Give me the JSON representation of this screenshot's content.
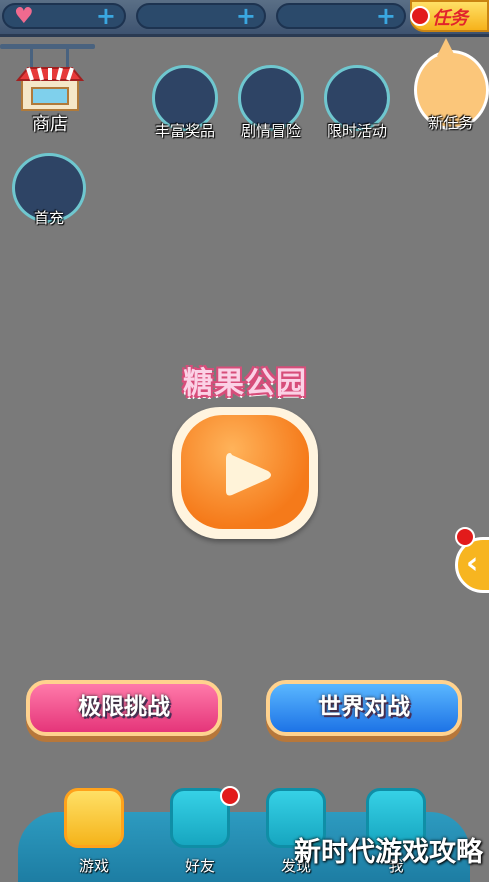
{
  "topbar": {
    "heart_icon": "heart-icon",
    "plus": "+",
    "task_label": "任务"
  },
  "side": {
    "shop_label": "商店",
    "first_recharge_label": "首充"
  },
  "activities": [
    {
      "label": "丰富奖品"
    },
    {
      "label": "剧情冒险"
    },
    {
      "label": "限时活动"
    }
  ],
  "new_task_label": "新任务",
  "center": {
    "title": "糖果公园"
  },
  "side_arrow": "‹",
  "modes": {
    "left_label": "极限挑战",
    "right_label": "世界对战"
  },
  "nav": [
    {
      "label": "游戏",
      "color": "#ffd23a"
    },
    {
      "label": "好友",
      "color": "#1fb7cf"
    },
    {
      "label": "发现",
      "color": "#1fb7cf"
    },
    {
      "label": "我",
      "color": "#1fb7cf"
    }
  ],
  "watermark": "新时代游戏攻略",
  "colors": {
    "background": "#7a7a7a",
    "accent_red": "#e21b1b",
    "pink_button": "#ef4f8a",
    "blue_button": "#2d8df0"
  }
}
